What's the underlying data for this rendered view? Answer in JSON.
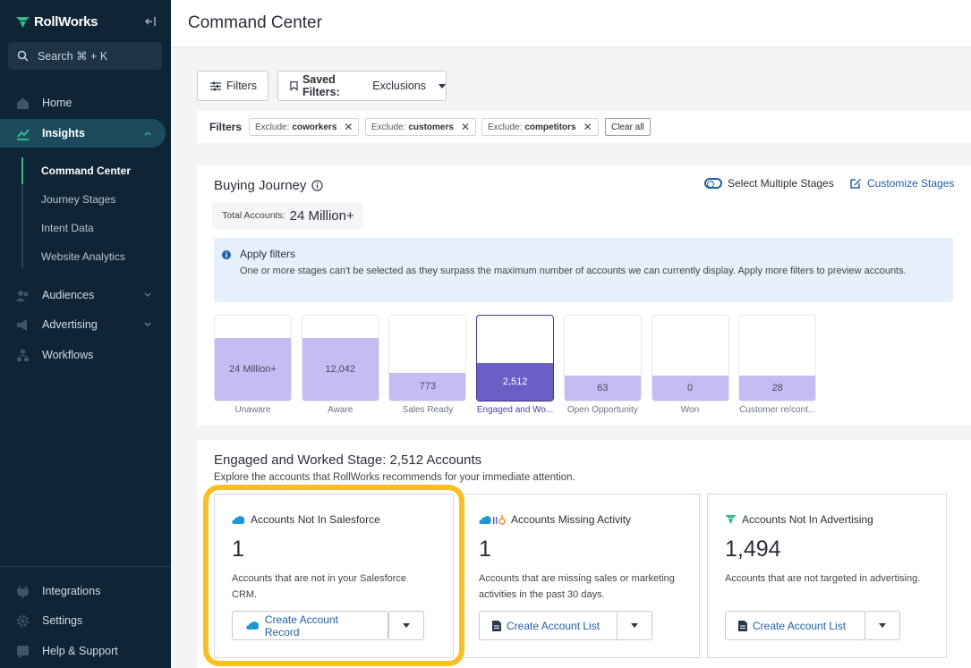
{
  "app": {
    "logo_text": "RollWorks"
  },
  "search": {
    "placeholder": "Search ⌘ + K"
  },
  "nav": {
    "home": "Home",
    "insights": "Insights",
    "insights_sub": [
      "Command Center",
      "Journey Stages",
      "Intent Data",
      "Website Analytics"
    ],
    "audiences": "Audiences",
    "advertising": "Advertising",
    "workflows": "Workflows",
    "integrations": "Integrations",
    "settings": "Settings",
    "help": "Help & Support"
  },
  "header": {
    "title": "Command Center"
  },
  "toolbar": {
    "filters_label": "Filters",
    "saved_filters_label": "Saved Filters:",
    "saved_filters_value": "Exclusions"
  },
  "filter_chips": {
    "label": "Filters",
    "chips": [
      {
        "prefix": "Exclude:",
        "value": "coworkers"
      },
      {
        "prefix": "Exclude:",
        "value": "customers"
      },
      {
        "prefix": "Exclude:",
        "value": "competitors"
      }
    ],
    "clear_all": "Clear all"
  },
  "buying_journey": {
    "title": "Buying Journey",
    "total_label": "Total Accounts:",
    "total_value": "24 Million+",
    "select_multiple": "Select Multiple Stages",
    "customize": "Customize Stages",
    "info_title": "Apply filters",
    "info_text": "One or more stages can't be selected as they surpass the maximum number of accounts we can currently display. Apply more filters to preview accounts.",
    "stages": [
      {
        "label": "Unaware",
        "value": "24 Million+",
        "fill": 0.74,
        "selected": false
      },
      {
        "label": "Aware",
        "value": "12,042",
        "fill": 0.74,
        "selected": false
      },
      {
        "label": "Sales Ready",
        "value": "773",
        "fill": 0.33,
        "selected": false
      },
      {
        "label": "Engaged and Wo...",
        "value": "2,512",
        "fill": 0.44,
        "selected": true
      },
      {
        "label": "Open Opportunity",
        "value": "63",
        "fill": 0.29,
        "selected": false
      },
      {
        "label": "Won",
        "value": "0",
        "fill": 0.29,
        "selected": false
      },
      {
        "label": "Customer re/cont...",
        "value": "28",
        "fill": 0.29,
        "selected": false
      }
    ]
  },
  "engaged": {
    "title": "Engaged and Worked Stage: 2,512 Accounts",
    "subtitle": "Explore the accounts that RollWorks recommends for your immediate attention.",
    "cards": [
      {
        "title": "Accounts Not In Salesforce",
        "count": "1",
        "desc": "Accounts that are not in your Salesforce CRM.",
        "button": "Create Account Record"
      },
      {
        "title": "Accounts Missing Activity",
        "count": "1",
        "desc": "Accounts that are missing sales or marketing activities in the past 30 days.",
        "button": "Create Account List"
      },
      {
        "title": "Accounts Not In Advertising",
        "count": "1,494",
        "desc": "Accounts that are not targeted in advertising.",
        "button": "Create Account List"
      }
    ]
  },
  "colors": {
    "sidebar_bg": "#0f2535",
    "accent_green": "#2fb98f",
    "link_blue": "#1f5fa8",
    "stage_fill": "#c3bdf3",
    "stage_selected": "#6a5fc4",
    "highlight": "#fbbf24"
  }
}
